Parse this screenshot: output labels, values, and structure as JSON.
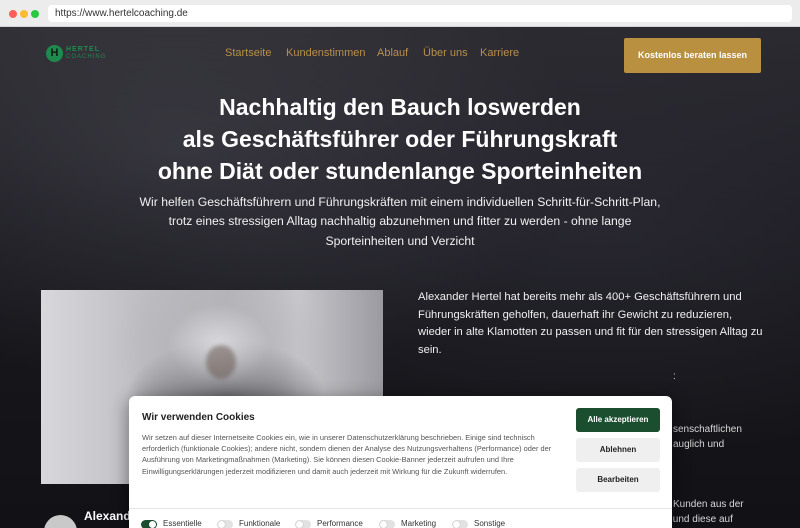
{
  "browser": {
    "url": "https://www.hertelcoaching.de"
  },
  "header": {
    "logo": {
      "mark": "H",
      "line1": "HERTEL",
      "line2": "COACHING"
    },
    "nav": [
      "Startseite",
      "Kundenstimmen",
      "Ablauf",
      "Über uns",
      "Karriere"
    ],
    "cta_label": "Kostenlos beraten lassen"
  },
  "hero": {
    "title_lines": [
      "Nachhaltig den Bauch loswerden",
      "als Geschäftsführer oder Führungskraft",
      "ohne Diät oder stundenlange Sporteinheiten"
    ],
    "subtitle_lines": [
      "Wir helfen Geschäftsführern und Führungskräften mit einem individuellen Schritt-für-Schritt-Plan,",
      "trotz eines stressigen Alltag nachhaltig abzunehmen und fitter zu werden - ohne lange",
      "Sporteinheiten und Verzicht"
    ]
  },
  "about": {
    "text": "Alexander Hertel hat bereits mehr als 400+ Geschäftsführern und Führungskräften geholfen, dauerhaft ihr Gewicht zu reduzieren, wieder in alte Klamotten zu passen und fit für den stressigen Alltag zu sein.",
    "partial_1": ":",
    "partial_2": "senschaftlichen",
    "partial_3": "auglich und",
    "partial_4": "Kunden aus der",
    "partial_5": "DACH-Region erfolgreich beim Abnehmen geholfen und diese auf"
  },
  "person": {
    "name": "Alexander Hertel"
  },
  "cookie": {
    "title": "Wir verwenden Cookies",
    "text": "Wir setzen auf dieser Internetseite Cookies ein, wie in unserer Datenschutzerklärung beschrieben. Einige sind technisch erforderlich (funktionale Cookies); andere nicht, sondern dienen der Analyse des Nutzungsverhaltens (Performance) oder der Ausführung von Marketingmaßnahmen (Marketing). Sie können diesen Cookie-Banner jederzeit aufrufen und Ihre Einwilligungserklärungen jederzeit modifizieren und damit auch jederzeit mit Wirkung für die Zukunft widerrufen.",
    "accept_label": "Alle akzeptieren",
    "decline_label": "Ablehnen",
    "settings_label": "Bearbeiten",
    "toggles": [
      {
        "label": "Essentielle",
        "on": true
      },
      {
        "label": "Funktionale",
        "on": false
      },
      {
        "label": "Performance",
        "on": false
      },
      {
        "label": "Marketing",
        "on": false
      },
      {
        "label": "Sonstige",
        "on": false
      }
    ]
  },
  "colors": {
    "accent_gold": "#b98f40",
    "brand_green": "#1f8a4d",
    "accept_green": "#1b4d2f"
  }
}
